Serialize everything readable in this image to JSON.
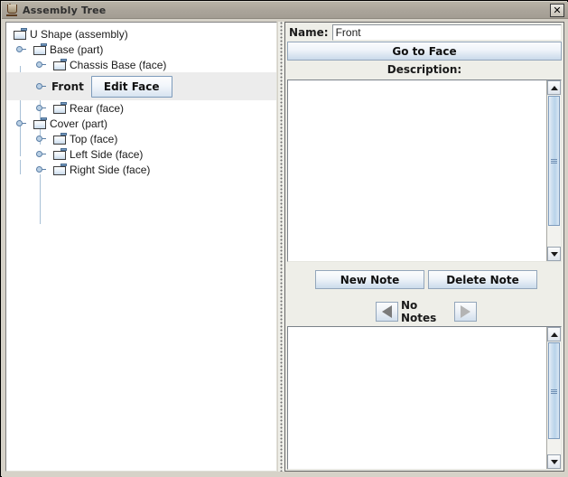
{
  "window": {
    "title": "Assembly Tree",
    "app_icon": "java-coffee-cup-icon",
    "close_label": "✕"
  },
  "tree": {
    "nodes": [
      {
        "label": "U Shape (assembly)",
        "depth": 0,
        "icon": "folder-icon",
        "handle": false
      },
      {
        "label": "Base (part)",
        "depth": 1,
        "icon": "folder-icon",
        "handle": true
      },
      {
        "label": "Chassis Base (face)",
        "depth": 2,
        "icon": "folder-icon",
        "handle": true
      },
      {
        "label": "Rear (face)",
        "depth": 2,
        "icon": "folder-icon",
        "handle": true
      },
      {
        "label": "Cover (part)",
        "depth": 1,
        "icon": "folder-icon",
        "handle": true
      },
      {
        "label": "Top (face)",
        "depth": 2,
        "icon": "folder-icon",
        "handle": true
      },
      {
        "label": "Left Side (face)",
        "depth": 2,
        "icon": "folder-icon",
        "handle": true
      },
      {
        "label": "Right Side (face)",
        "depth": 2,
        "icon": "folder-icon",
        "handle": true
      }
    ],
    "editing_row": {
      "name": "Front",
      "button_label": "Edit Face"
    }
  },
  "details": {
    "name_label": "Name:",
    "name_value": "Front",
    "goto_face_label": "Go to Face",
    "description_label": "Description:",
    "description_value": "",
    "new_note_label": "New Note",
    "delete_note_label": "Delete Note",
    "note_counter": "No Notes",
    "prev_icon": "arrow-left-icon",
    "next_icon": "arrow-right-icon",
    "note_body_value": ""
  },
  "colors": {
    "titlebar": "#aaa49a",
    "panel_bg": "#eeeee8",
    "button_accent": "#c9d9ea",
    "scroll_thumb": "#b9d3ea",
    "selection_bg": "#ececec"
  }
}
